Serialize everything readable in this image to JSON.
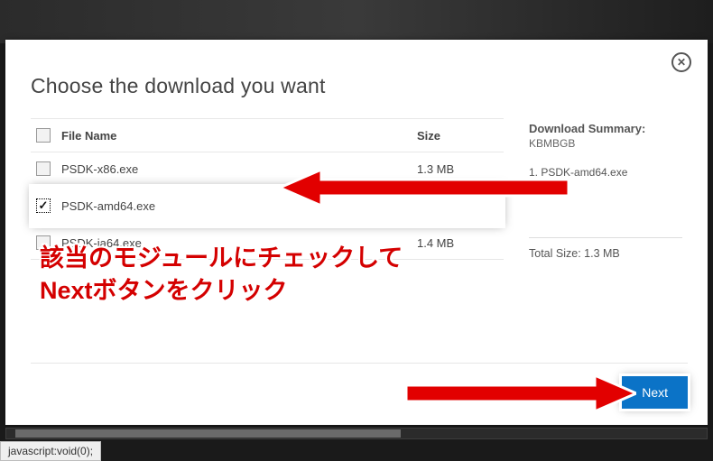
{
  "dialog": {
    "title": "Choose the download you want",
    "close_label": "✕",
    "columns": {
      "name": "File Name",
      "size": "Size"
    },
    "files": [
      {
        "name": "PSDK-x86.exe",
        "size": "1.3 MB",
        "checked": false
      },
      {
        "name": "PSDK-amd64.exe",
        "size": "",
        "checked": true
      },
      {
        "name": "PSDK-ia64.exe",
        "size": "1.4 MB",
        "checked": false
      }
    ],
    "summary": {
      "title": "Download Summary:",
      "sub": "KBMBGB",
      "items": [
        "1. PSDK-amd64.exe"
      ],
      "total_label": "Total Size: 1.3 MB"
    },
    "next_label": "Next"
  },
  "annotation": {
    "line1": "該当のモジュールにチェックして",
    "line2": "Nextボタンをクリック"
  },
  "status_bar": "javascript:void(0);"
}
